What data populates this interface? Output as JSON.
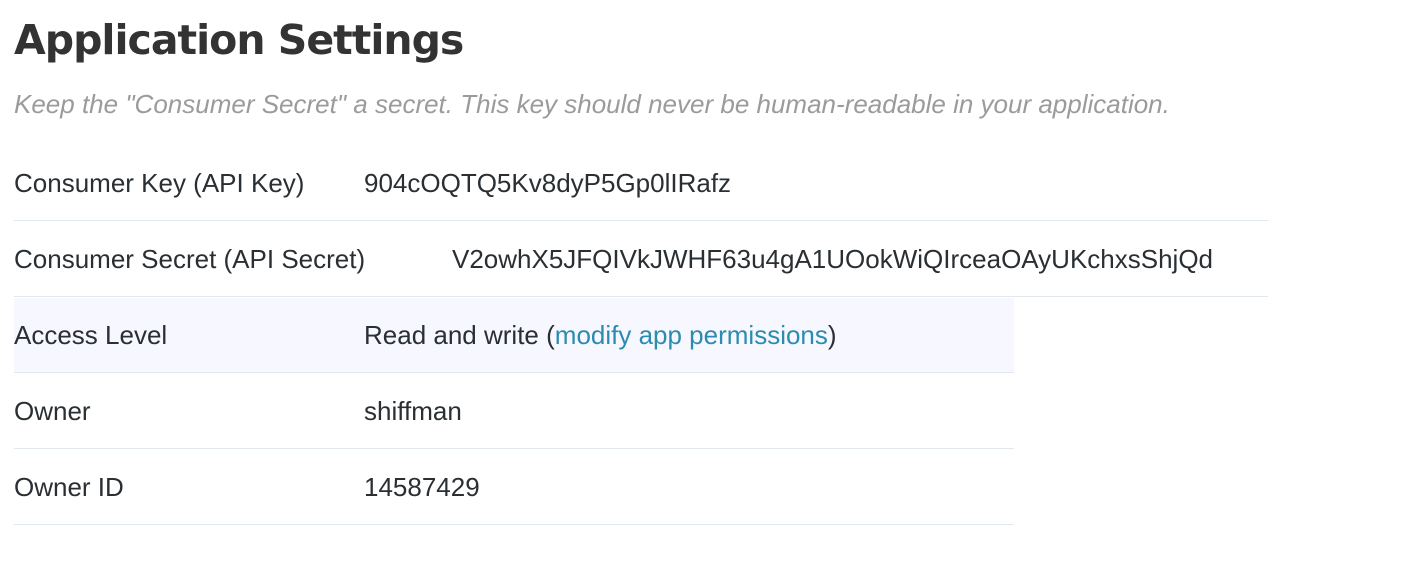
{
  "header": {
    "title": "Application Settings",
    "subtitle": "Keep the \"Consumer Secret\" a secret. This key should never be human-readable in your application."
  },
  "settings": {
    "consumer_key": {
      "label": "Consumer Key (API Key)",
      "value": "904cOQTQ5Kv8dyP5Gp0lIRafz"
    },
    "consumer_secret": {
      "label": "Consumer Secret (API Secret)",
      "value": "V2owhX5JFQIVkJWHF63u4gA1UOokWiQIrceaOAyUKchxsShjQd"
    },
    "access_level": {
      "label": "Access Level",
      "value": "Read and write",
      "paren_open": " (",
      "link": "modify app permissions",
      "paren_close": ")"
    },
    "owner": {
      "label": "Owner",
      "value": "shiffman"
    },
    "owner_id": {
      "label": "Owner ID",
      "value": "14587429"
    }
  },
  "colors": {
    "link": "#2b8bb0",
    "subtitle": "#9b9b9b",
    "row_highlight": "#f7f8ff",
    "divider": "#e1e8ed"
  }
}
